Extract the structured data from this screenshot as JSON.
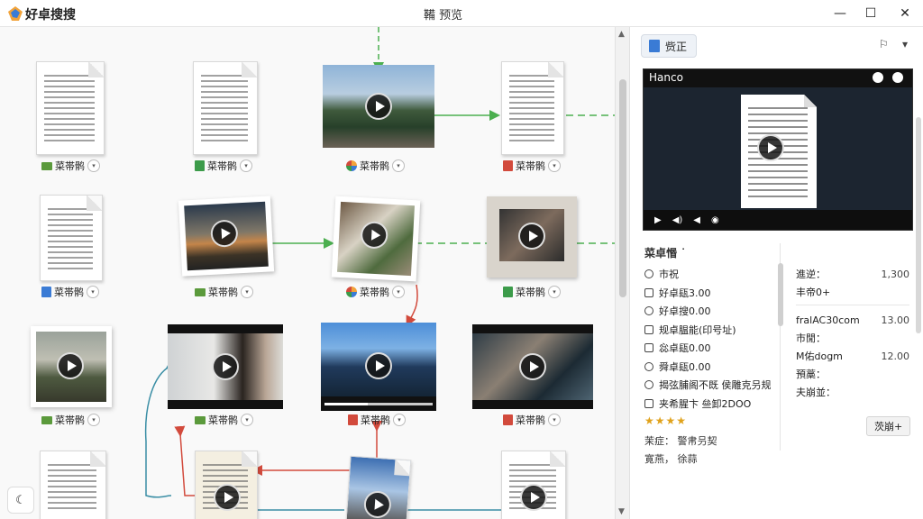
{
  "app": {
    "name": "好卓搜搜",
    "window_title": "鞴 预览"
  },
  "window_buttons": {
    "minimize": "—",
    "maximize": "☐",
    "close": "✕"
  },
  "nodes": [
    {
      "label": "菜帯鹘",
      "icon": "folder-icon"
    },
    {
      "label": "菜帯鹘",
      "icon": "sheet-icon"
    },
    {
      "label": "菜帯鹘",
      "icon": "multi-icon"
    },
    {
      "label": "菜帯鹘",
      "icon": "red-file-icon"
    },
    {
      "label": "菜帯鹘",
      "icon": "doc-icon"
    },
    {
      "label": "菜帯鹘",
      "icon": "folder-icon"
    },
    {
      "label": "菜帯鹘",
      "icon": "multi-icon"
    },
    {
      "label": "菜帯鹘",
      "icon": "sheet-icon"
    },
    {
      "label": "菜帯鹘",
      "icon": "folder-icon"
    },
    {
      "label": "菜帯鹘",
      "icon": "folder-icon"
    },
    {
      "label": "菜帯鹘",
      "icon": "red-file-icon"
    },
    {
      "label": "菜帯鹘",
      "icon": "red-file-icon"
    }
  ],
  "panel": {
    "tab_label": "赀正",
    "player": {
      "title": "Hanco"
    },
    "meta_title": "菜卓惽 ˙",
    "meta_rows": [
      "市祝",
      "好卓瓺3.00",
      "好卓搜0.00",
      "规卓腽能(印号址)",
      "惢卓瓺0.00",
      "舜卓瓺0.00",
      "揭弦脯阁不既 侯雕克叧规",
      "夹希腥卞 亝卸2DOO"
    ],
    "rating": "★★★★",
    "extra_lines": [
      "茉症： 警帇叧契",
      "寛燕， 徐蒜"
    ],
    "stats": [
      {
        "k": "進逆：",
        "v": "1,300"
      },
      {
        "k": "丰帝0+",
        "v": ""
      },
      {
        "k": "fralAC30com",
        "v": "13.00"
      },
      {
        "k": "市閒：",
        "v": ""
      },
      {
        "k": "M佑dogm",
        "v": "12.00"
      },
      {
        "k": "預藁：",
        "v": ""
      },
      {
        "k": "夫崩並：",
        "v": ""
      }
    ],
    "button_label": "茨崩+"
  },
  "colors": {
    "accent": "#3a7bd5",
    "edge_green": "#4caf50",
    "edge_red": "#d24a3c",
    "edge_teal": "#3a8ea5"
  }
}
